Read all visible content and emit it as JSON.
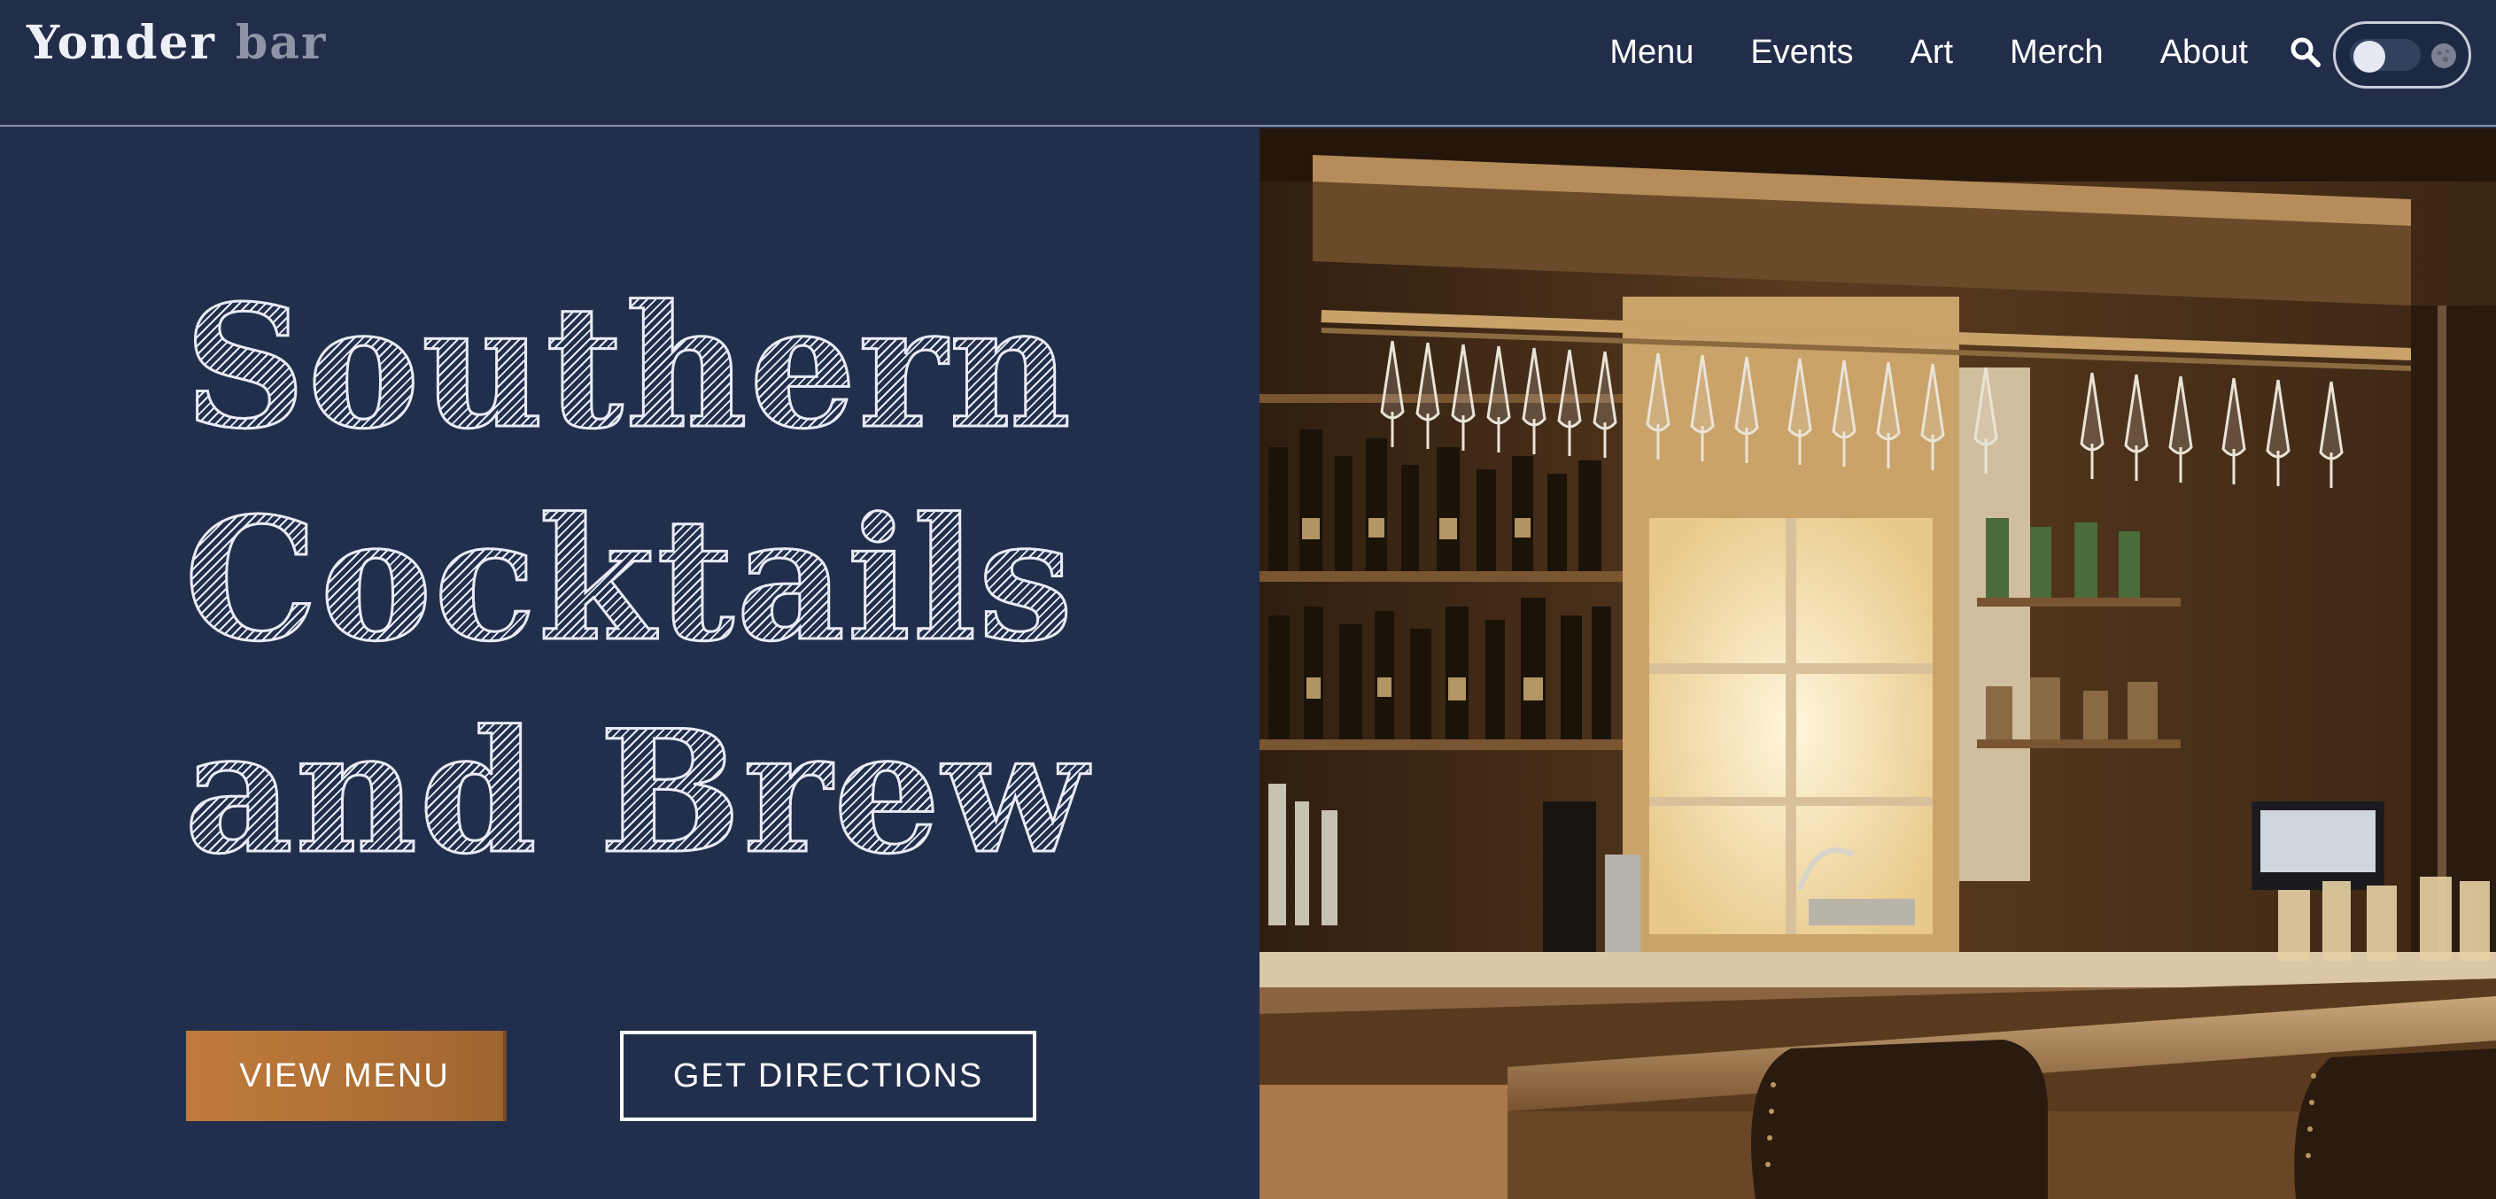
{
  "header": {
    "logo_main": "Yonder",
    "logo_sub": "bar",
    "nav": [
      "Menu",
      "Events",
      "Art",
      "Merch",
      "About"
    ]
  },
  "hero": {
    "headline_lines": [
      "Southern",
      "Cocktails",
      "and Brew"
    ],
    "primary_button": "VIEW MENU",
    "secondary_button": "GET DIRECTIONS"
  },
  "icons": {
    "search": "search-icon",
    "theme_toggle": "theme-toggle",
    "moon": "moon-icon",
    "hero_image": "bar-interior-photo"
  },
  "colors": {
    "background": "#222f4c",
    "accent": "#b87236",
    "text": "#ffffff"
  }
}
